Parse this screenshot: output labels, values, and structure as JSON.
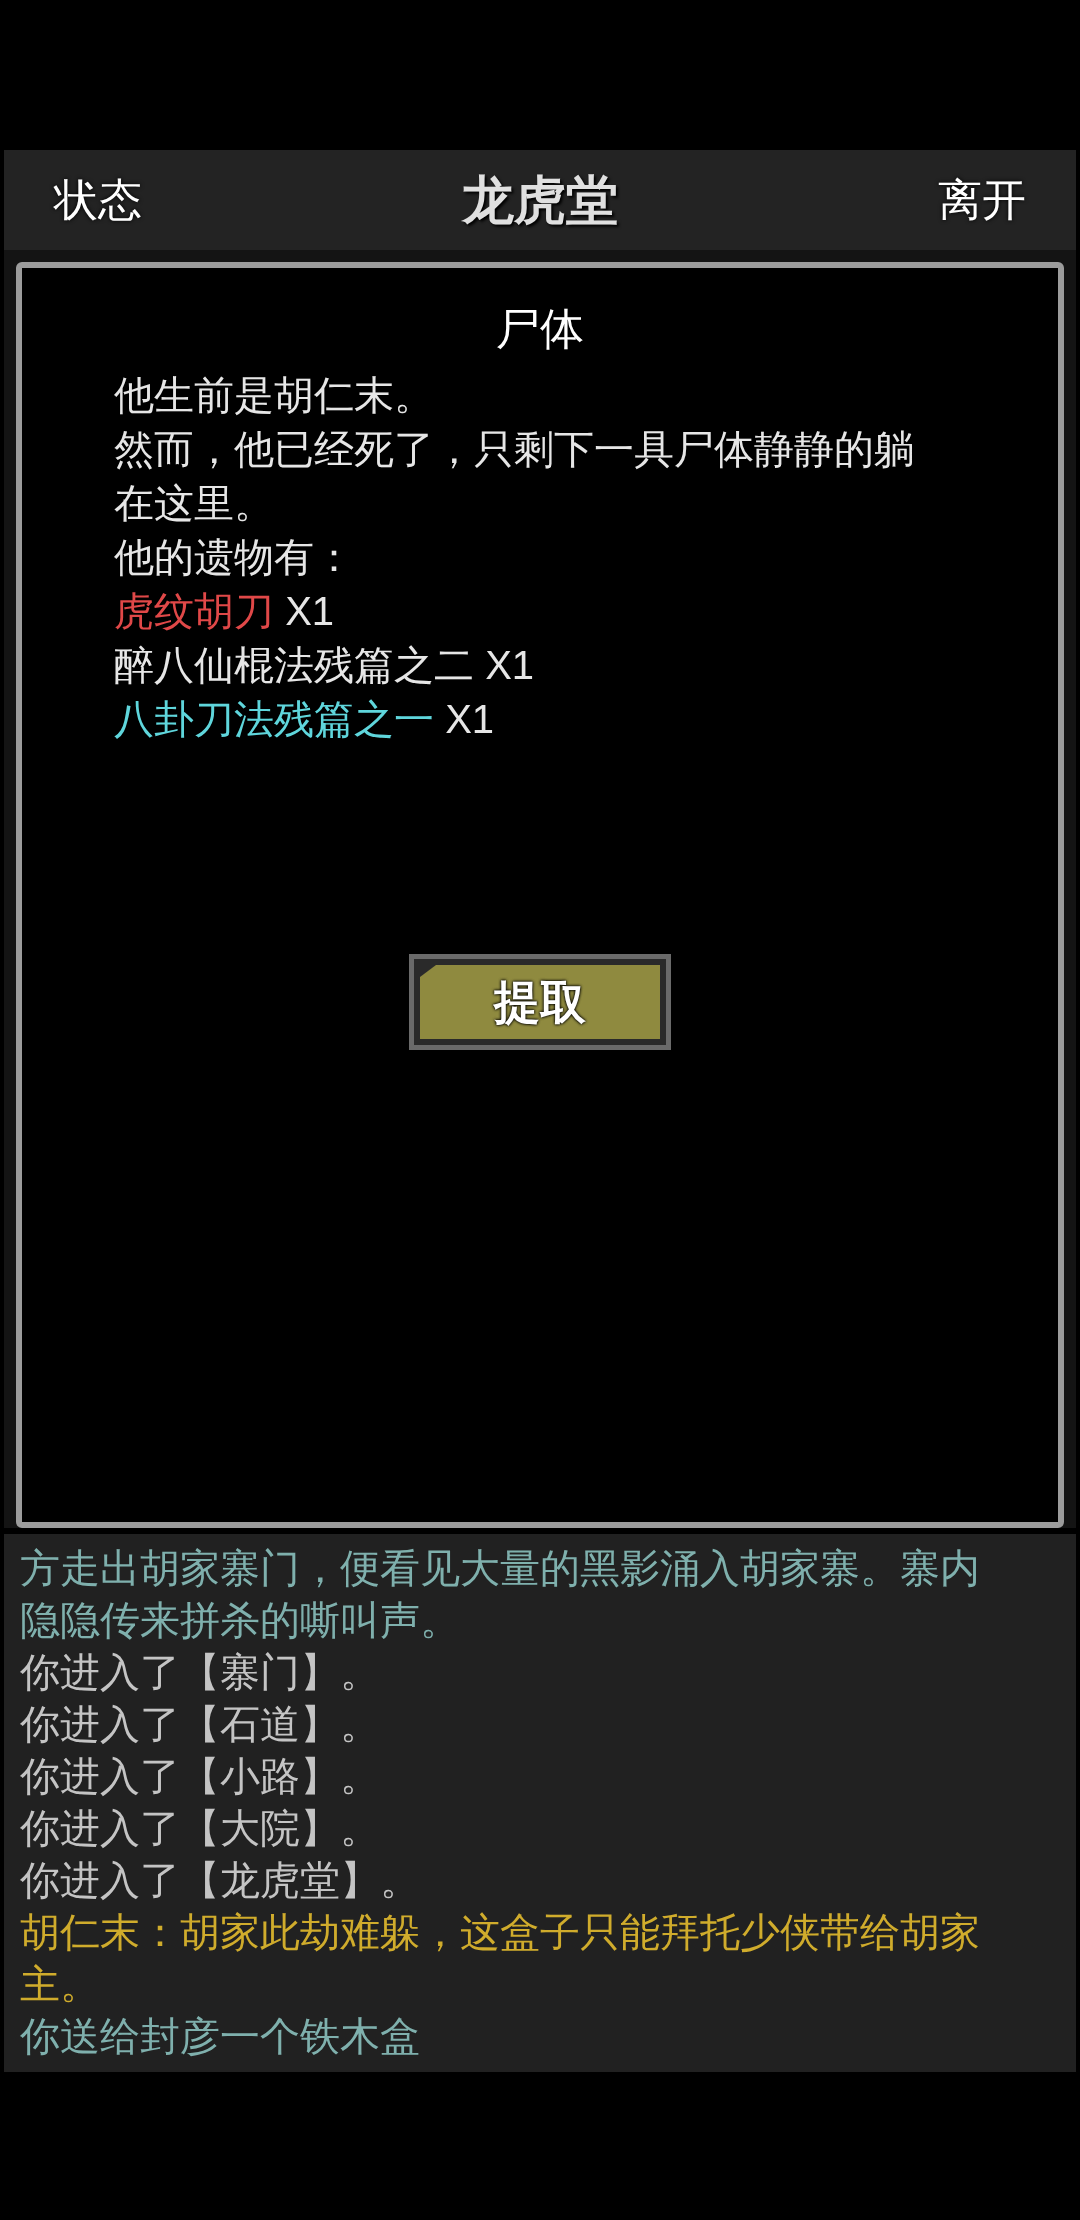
{
  "header": {
    "left_button": "状态",
    "title": "龙虎堂",
    "right_button": "离开"
  },
  "dialog": {
    "title": "尸体",
    "lines": [
      "他生前是胡仁末。",
      "然而，他已经死了，只剩下一具尸体静静的躺在这里。",
      "他的遗物有："
    ],
    "items": [
      {
        "name": "虎纹胡刀",
        "count": "X1",
        "color": "#e04848"
      },
      {
        "name": "醉八仙棍法残篇之二",
        "count": "X1",
        "color": "#e6e6e6"
      },
      {
        "name": "八卦刀法残篇之一",
        "count": "X1",
        "color": "#5fd6dc"
      }
    ],
    "button": "提取"
  },
  "log": [
    {
      "kind": "narration",
      "text": "方走出胡家寨门，便看见大量的黑影涌入胡家寨。寨内隐隐传来拼杀的嘶叫声。"
    },
    {
      "kind": "normal",
      "text": "你进入了【寨门】。"
    },
    {
      "kind": "normal",
      "text": "你进入了【石道】。"
    },
    {
      "kind": "normal",
      "text": "你进入了【小路】。"
    },
    {
      "kind": "normal",
      "text": "你进入了【大院】。"
    },
    {
      "kind": "normal",
      "text": "你进入了【龙虎堂】。"
    },
    {
      "kind": "dialogue",
      "text": "胡仁末：胡家此劫难躲，这盒子只能拜托少侠带给胡家主。"
    },
    {
      "kind": "narration",
      "text": "你送给封彦一个铁木盒"
    }
  ]
}
